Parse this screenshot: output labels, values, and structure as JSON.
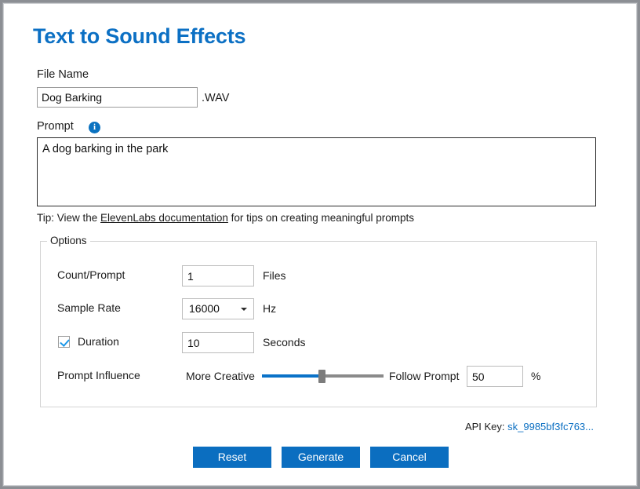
{
  "window": {
    "title": "Text to Sound Effects"
  },
  "file_name": {
    "label": "File Name",
    "value": "Dog Barking",
    "extension": ".WAV"
  },
  "prompt": {
    "label": "Prompt",
    "info_icon": "info-icon",
    "value": "A dog barking in the park",
    "tip_prefix": "Tip: View the ",
    "tip_link": "ElevenLabs documentation",
    "tip_suffix": " for tips on creating meaningful prompts"
  },
  "options": {
    "legend": "Options",
    "count": {
      "label": "Count/Prompt",
      "value": "1",
      "unit": "Files"
    },
    "sample_rate": {
      "label": "Sample Rate",
      "value": "16000",
      "unit": "Hz",
      "arrow_icon": "chevron-down-icon"
    },
    "duration": {
      "label": "Duration",
      "checked": true,
      "value": "10",
      "unit": "Seconds"
    },
    "prompt_influence": {
      "label": "Prompt Influence",
      "left_label": "More Creative",
      "right_label": "Follow Prompt",
      "value": "50",
      "unit": "%",
      "slider_percent": 50
    }
  },
  "api_key": {
    "label": "API Key: ",
    "value": "sk_9985bf3fc763..."
  },
  "buttons": {
    "reset": "Reset",
    "generate": "Generate",
    "cancel": "Cancel"
  },
  "colors": {
    "title_blue": "#0c70c4",
    "button_blue": "#0b6ec0",
    "slider_blue": "#0a72c8",
    "check_blue": "#1c97e8",
    "link_blue": "#0b6fc2"
  }
}
